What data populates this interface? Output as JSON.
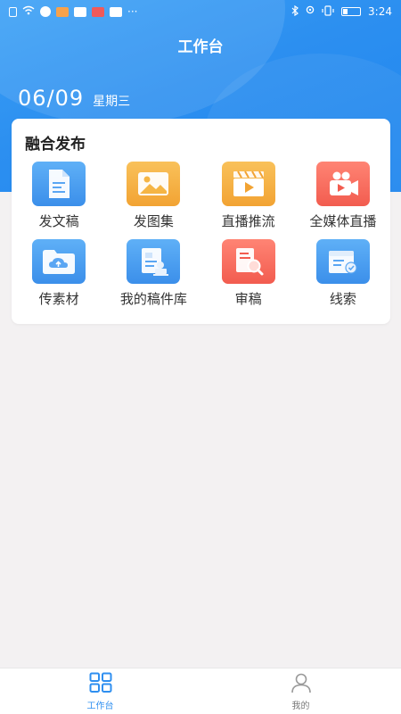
{
  "status_bar": {
    "time": "3:24",
    "icons": [
      "sim-icon",
      "wifi-icon",
      "app-icon",
      "app-icon",
      "app-icon",
      "app-icon",
      "app-icon"
    ],
    "more": "···",
    "right_icons": [
      "bluetooth-icon",
      "location-icon",
      "vibrate-icon",
      "battery-icon"
    ]
  },
  "header": {
    "title": "工作台"
  },
  "date": {
    "day": "06/09",
    "weekday": "星期三"
  },
  "section": {
    "title": "融合发布",
    "items": [
      {
        "label": "发文稿",
        "icon": "document-icon",
        "color": "#4a9ff3"
      },
      {
        "label": "发图集",
        "icon": "image-icon",
        "color": "#f5b545"
      },
      {
        "label": "直播推流",
        "icon": "clapperboard-icon",
        "color": "#f5b545"
      },
      {
        "label": "全媒体直播",
        "icon": "video-camera-icon",
        "color": "#f66a5c"
      },
      {
        "label": "传素材",
        "icon": "cloud-upload-folder-icon",
        "color": "#4a9ff3"
      },
      {
        "label": "我的稿件库",
        "icon": "manuscript-library-icon",
        "color": "#4a9ff3"
      },
      {
        "label": "审稿",
        "icon": "review-icon",
        "color": "#f66a5c"
      },
      {
        "label": "线索",
        "icon": "clue-icon",
        "color": "#4a9ff3"
      }
    ]
  },
  "tabbar": {
    "tabs": [
      {
        "label": "工作台",
        "icon": "grid-icon",
        "active": true
      },
      {
        "label": "我的",
        "icon": "user-icon",
        "active": false
      }
    ],
    "active_color": "#2f8ff0"
  }
}
